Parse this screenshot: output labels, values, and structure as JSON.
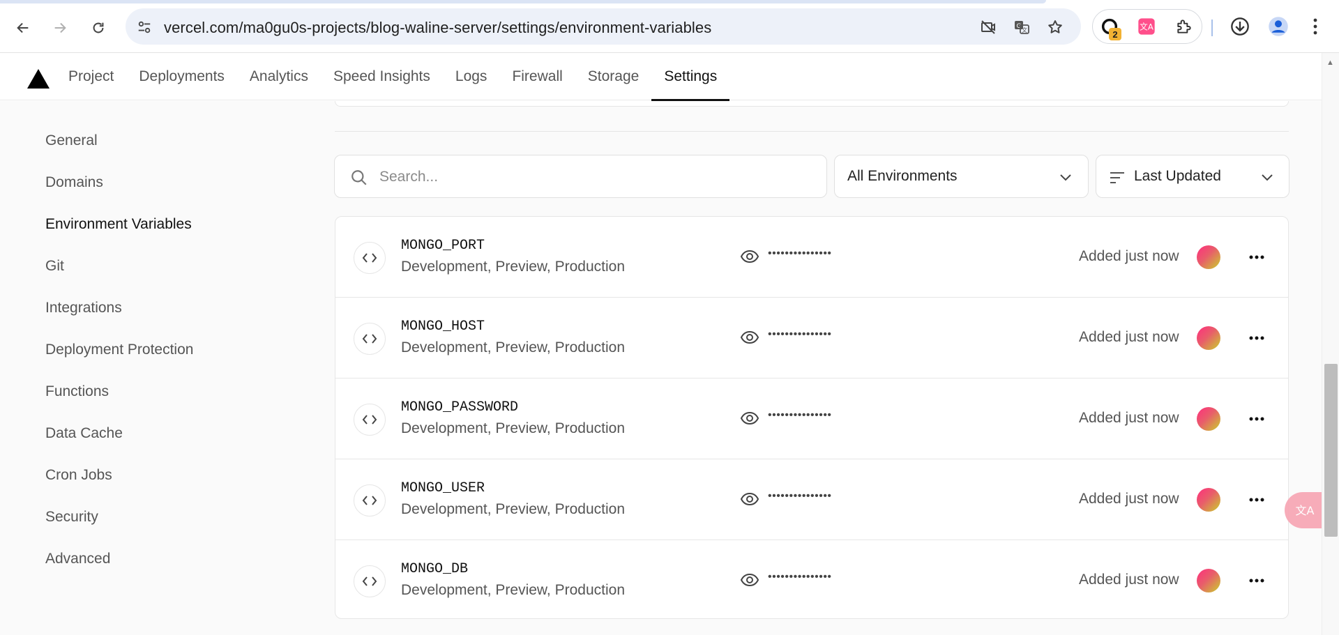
{
  "browser": {
    "url": "vercel.com/ma0gu0s-projects/blog-waline-server/settings/environment-variables",
    "extension_badge": "2"
  },
  "nav": {
    "tabs": [
      {
        "label": "Project"
      },
      {
        "label": "Deployments"
      },
      {
        "label": "Analytics"
      },
      {
        "label": "Speed Insights"
      },
      {
        "label": "Logs"
      },
      {
        "label": "Firewall"
      },
      {
        "label": "Storage"
      },
      {
        "label": "Settings",
        "active": true
      }
    ]
  },
  "sidebar": {
    "items": [
      {
        "label": "General"
      },
      {
        "label": "Domains"
      },
      {
        "label": "Environment Variables",
        "active": true
      },
      {
        "label": "Git"
      },
      {
        "label": "Integrations"
      },
      {
        "label": "Deployment Protection"
      },
      {
        "label": "Functions"
      },
      {
        "label": "Data Cache"
      },
      {
        "label": "Cron Jobs"
      },
      {
        "label": "Security"
      },
      {
        "label": "Advanced"
      }
    ]
  },
  "filters": {
    "search_placeholder": "Search...",
    "environment": "All Environments",
    "sort": "Last Updated"
  },
  "variables": [
    {
      "name": "MONGO_PORT",
      "environments": "Development, Preview, Production",
      "masked": "•••••••••••••••",
      "added": "Added just now"
    },
    {
      "name": "MONGO_HOST",
      "environments": "Development, Preview, Production",
      "masked": "•••••••••••••••",
      "added": "Added just now"
    },
    {
      "name": "MONGO_PASSWORD",
      "environments": "Development, Preview, Production",
      "masked": "•••••••••••••••",
      "added": "Added just now"
    },
    {
      "name": "MONGO_USER",
      "environments": "Development, Preview, Production",
      "masked": "•••••••••••••••",
      "added": "Added just now"
    },
    {
      "name": "MONGO_DB",
      "environments": "Development, Preview, Production",
      "masked": "•••••••••••••••",
      "added": "Added just now"
    }
  ],
  "colors": {
    "accent": "#111111",
    "avatar_gradient_start": "#ff2e7e",
    "avatar_gradient_end": "#c9d12b"
  }
}
